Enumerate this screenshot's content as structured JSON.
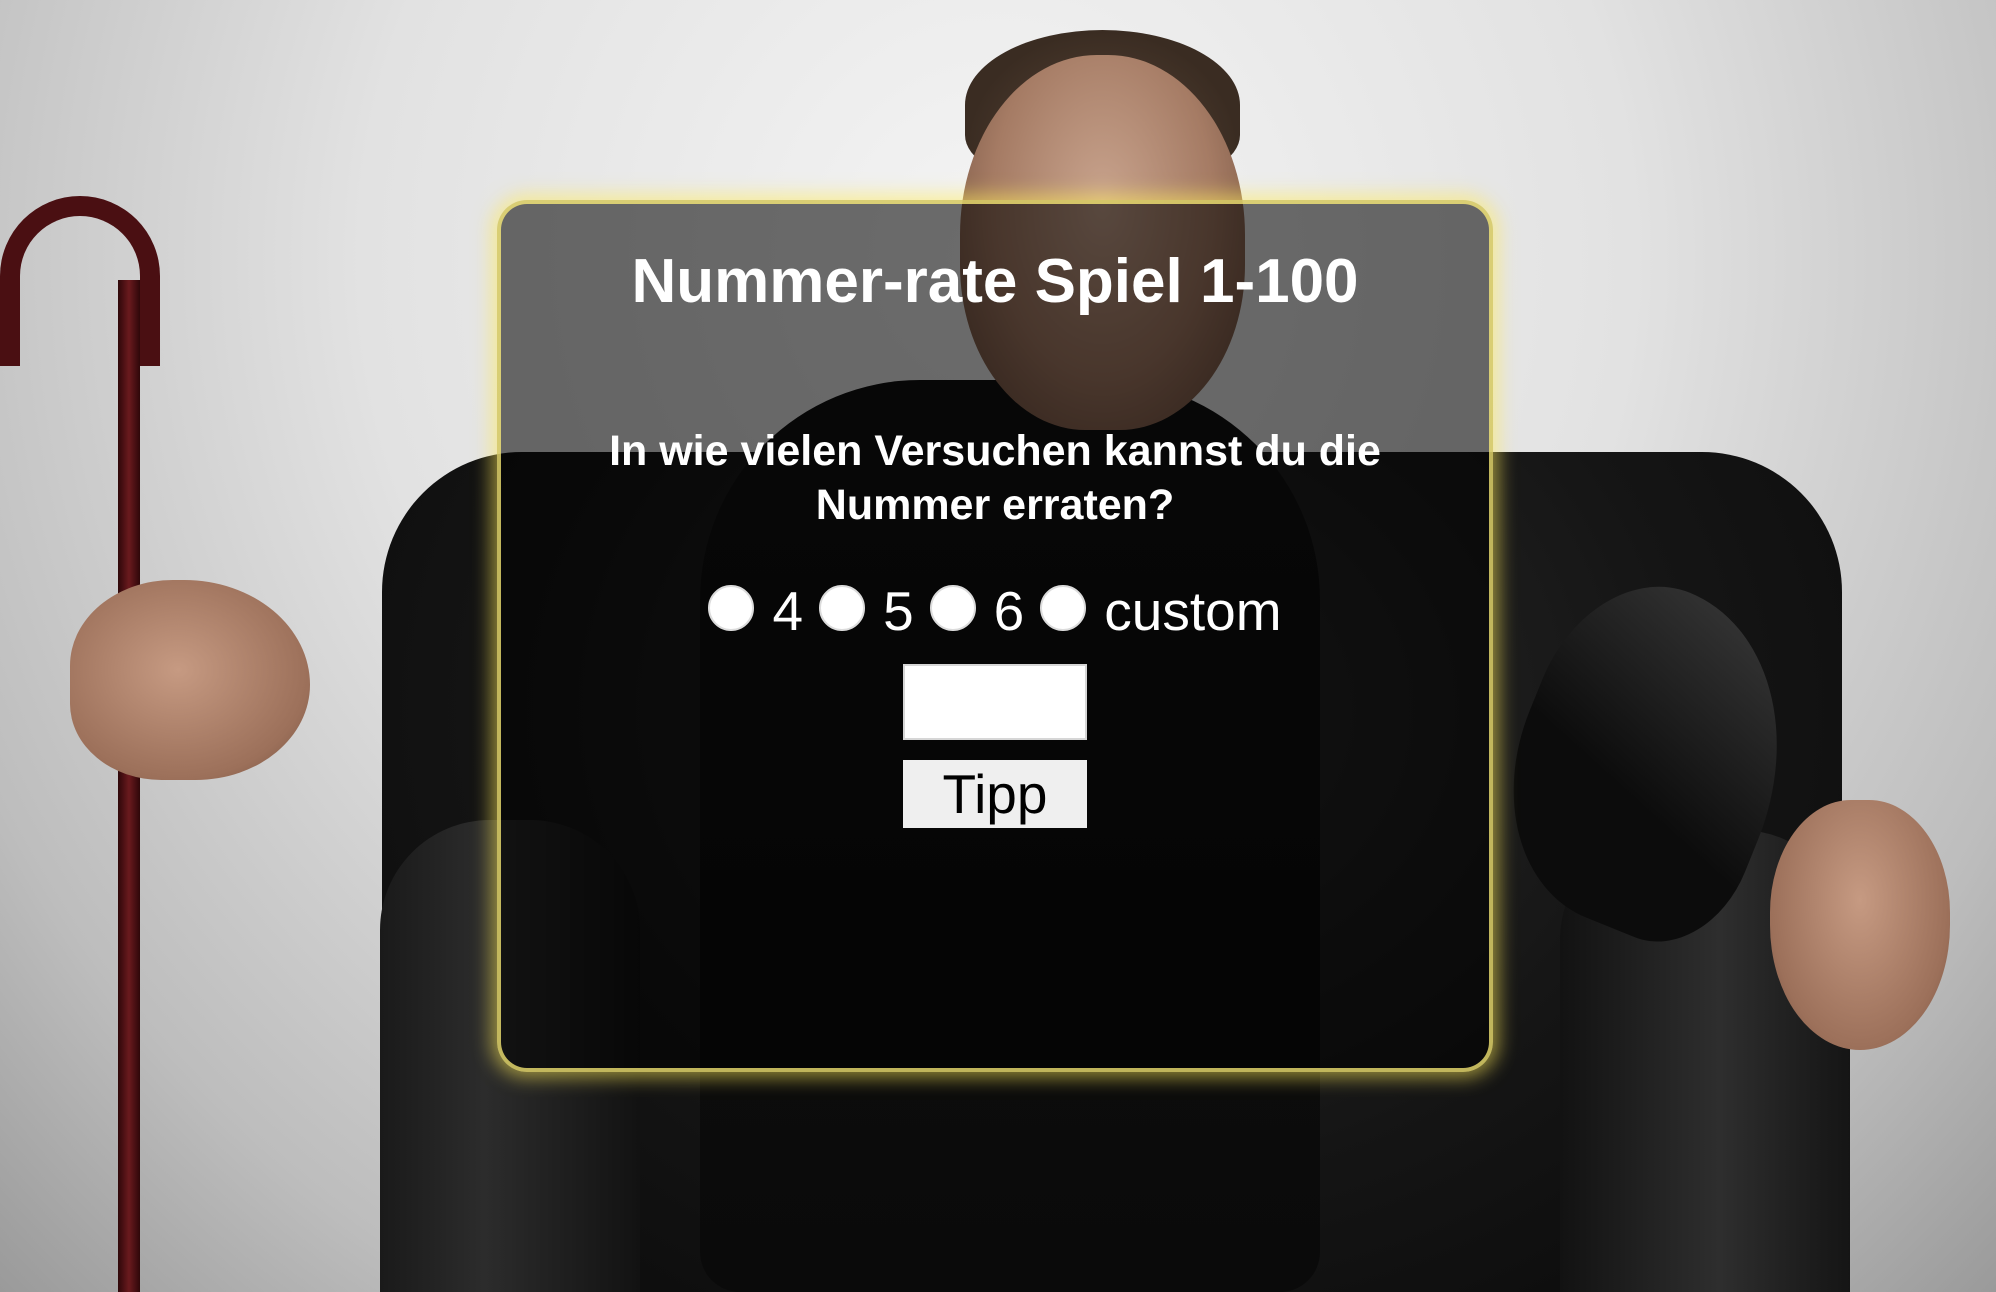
{
  "game": {
    "title": "Nummer-rate Spiel 1-100",
    "question": "In wie vielen Versuchen kannst du die Nummer erraten?",
    "attempt_options": [
      {
        "label": "4",
        "value": "4"
      },
      {
        "label": "5",
        "value": "5"
      },
      {
        "label": "6",
        "value": "6"
      },
      {
        "label": "custom",
        "value": "custom"
      }
    ],
    "guess_input": {
      "value": "",
      "placeholder": ""
    },
    "submit_label": "Tipp"
  },
  "colors": {
    "panel_background": "rgba(0,0,0,0.56)",
    "panel_glow": "#ffeb5a",
    "text": "#ffffff"
  }
}
